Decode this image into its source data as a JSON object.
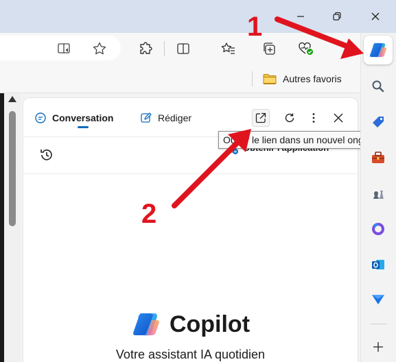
{
  "favorites": {
    "folder_label": "Autres favoris"
  },
  "copilot_pane": {
    "tabs": [
      {
        "label": "Conversation",
        "active": true
      },
      {
        "label": "Rédiger",
        "active": false
      }
    ],
    "get_app_label": "Obtenir l'application",
    "brand_name": "Copilot",
    "tagline": "Votre assistant IA quotidien"
  },
  "tooltip": {
    "text": "Ouvrir le lien dans un nouvel onglet"
  },
  "annotations": {
    "step1": "1",
    "step2": "2",
    "arrow_color": "#e0141e"
  },
  "icons": {
    "sidebar": [
      "copilot-icon",
      "search-icon",
      "shopping-tag-icon",
      "toolbox-icon",
      "chess-icon",
      "microsoft365-icon",
      "outlook-icon",
      "send-icon",
      "plus-icon"
    ],
    "toolbar": [
      "reader-mode-icon",
      "favorite-star-icon",
      "extensions-icon",
      "split-screen-icon",
      "favorites-icon",
      "collections-icon",
      "browser-essentials-icon"
    ]
  },
  "colors": {
    "accent": "#0f6cbd",
    "annotation_red": "#e0141e",
    "titlebar": "#d6e0ee"
  }
}
